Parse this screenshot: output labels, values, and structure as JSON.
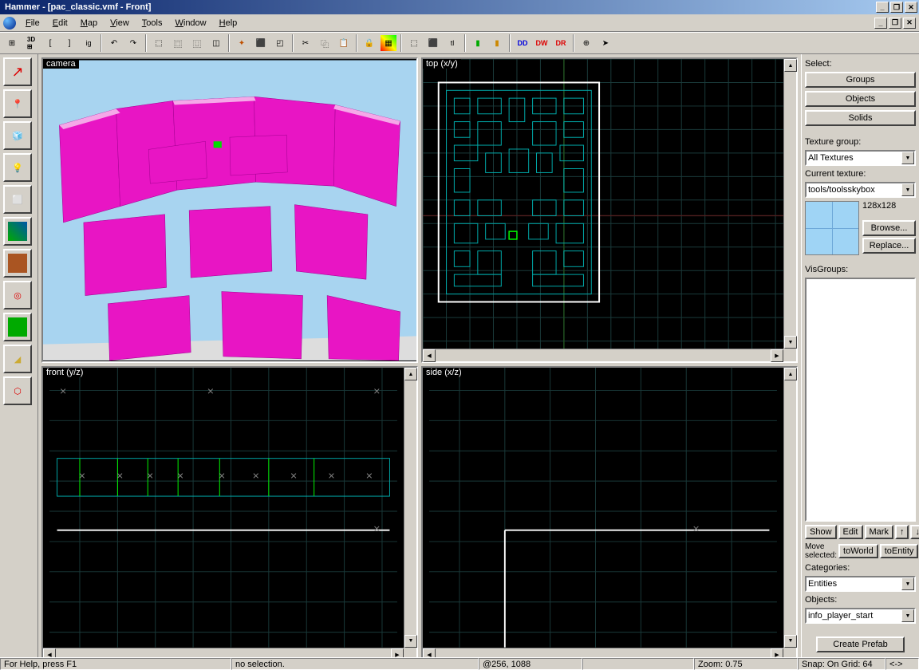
{
  "window": {
    "title": "Hammer - [pac_classic.vmf - Front]"
  },
  "menu": {
    "file": "File",
    "edit": "Edit",
    "map": "Map",
    "view": "View",
    "tools": "Tools",
    "window": "Window",
    "help": "Help"
  },
  "viewports": {
    "camera": "camera",
    "top": "top (x/y)",
    "front": "front (y/z)",
    "side": "side (x/z)"
  },
  "right": {
    "select_label": "Select:",
    "groups": "Groups",
    "objects": "Objects",
    "solids": "Solids",
    "texgroup_label": "Texture group:",
    "texgroup_value": "All Textures",
    "curtex_label": "Current texture:",
    "curtex_value": "tools/toolsskybox",
    "texsize": "128x128",
    "browse": "Browse...",
    "replace": "Replace...",
    "visgroups_label": "VisGroups:",
    "show": "Show",
    "editbtn": "Edit",
    "mark": "Mark",
    "move_sel_label": "Move\nselected:",
    "toworld": "toWorld",
    "toentity": "toEntity",
    "categories_label": "Categories:",
    "categories_value": "Entities",
    "objects_label": "Objects:",
    "objects_value": "info_player_start",
    "create_prefab": "Create Prefab"
  },
  "status": {
    "help": "For Help, press F1",
    "selection": "no selection.",
    "coords": "@256, 1088",
    "zoom": "Zoom: 0.75",
    "snap": "Snap: On Grid: 64",
    "arrows": "<->"
  },
  "colors": {
    "magenta": "#e815c4",
    "grid_teal": "#1a3a3a",
    "grid_2d": "#1a5555",
    "wall_cyan": "#00aaaa",
    "entity_green": "#00ff00"
  }
}
